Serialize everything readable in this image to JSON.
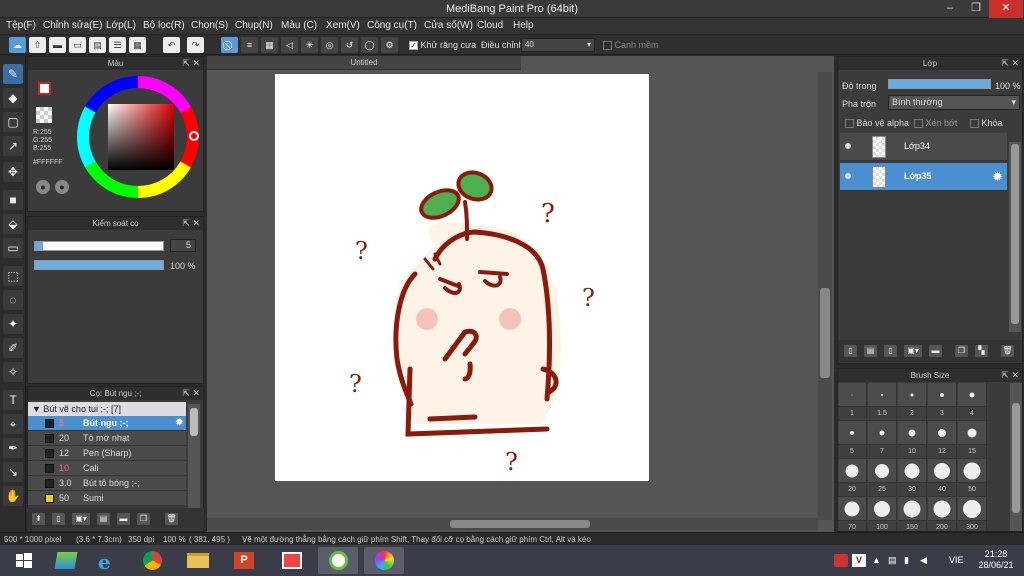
{
  "window": {
    "title": "MediBang Paint Pro (64bit)"
  },
  "menu": [
    "Tệp(F)",
    "Chỉnh sửa(E)",
    "Lớp(L)",
    "Bộ lọc(R)",
    "Chọn(S)",
    "Chụp(N)",
    "Màu (C)",
    "Xem(V)",
    "Công cụ(T)",
    "Cửa số(W)",
    "Cloud",
    "Help"
  ],
  "toolbar": {
    "antialias_label": "Khử răng cưa",
    "adjust_label": "Điều chỉnh",
    "adjust_value": "40",
    "smooth_label": "Canh mềm"
  },
  "color_panel": {
    "title": "Màu",
    "r": "R:255",
    "g": "G:255",
    "b": "B:255",
    "hex": "#FFFFFF",
    "primary": "#ffffff",
    "secondary": "#cc2222"
  },
  "brush_control": {
    "title": "Kiểm soát cọ",
    "size_value": "5",
    "size_fraction": 0.05,
    "opacity_value": "100 %",
    "opacity_fraction": 1.0
  },
  "brush_panel": {
    "title": "Cọ: Bút ngu ;-;",
    "group": "Bút vẽ cho tui ;-; [7]",
    "items": [
      {
        "size": "5",
        "name": "Bút ngu ;-;",
        "swatch": "#222222"
      },
      {
        "size": "20",
        "name": "Tô mờ nhạt",
        "swatch": "#222222"
      },
      {
        "size": "12",
        "name": "Pen (Sharp)",
        "swatch": "#222222"
      },
      {
        "size": "10",
        "name": "Cali",
        "swatch": "#222222"
      },
      {
        "size": "3.0",
        "name": "Bút tô bóng ;-;",
        "swatch": "#222222"
      },
      {
        "size": "50",
        "name": "Sumi",
        "swatch": "#e8d41a"
      }
    ]
  },
  "document": {
    "tab": "Untitled"
  },
  "layer_panel": {
    "title": "Lớp",
    "opacity_label": "Độ trong",
    "opacity_value": "100 %",
    "opacity_fraction": 1.0,
    "blend_label": "Pha trộn",
    "blend_value": "Bình thường",
    "protect_alpha": "Bảo vệ alpha",
    "clip": "Xén bớt",
    "lock": "Khóa",
    "layers": [
      {
        "name": "Lớp34"
      },
      {
        "name": "Lớp35"
      }
    ]
  },
  "brush_size": {
    "title": "Brush Size",
    "labels": [
      "1",
      "1.5",
      "2",
      "3",
      "4",
      "5",
      "7",
      "10",
      "12",
      "15",
      "20",
      "25",
      "30",
      "40",
      "50",
      "70",
      "100",
      "150",
      "200",
      "300"
    ]
  },
  "status": {
    "size": "500 * 1000 pixel",
    "dims": "(3.6 * 7.3cm)",
    "dpi": "350 dpi",
    "zoom": "100 %",
    "coords": "( 381, 495 )",
    "hint": "Vẽ một đường thẳng bằng cách giữ phím Shift, Thay đổi cỡ cọ bằng cách giữ phím Ctrl, Alt và kéo"
  },
  "taskbar": {
    "lang": "VIE",
    "time": "21:28",
    "date": "28/06/21"
  }
}
